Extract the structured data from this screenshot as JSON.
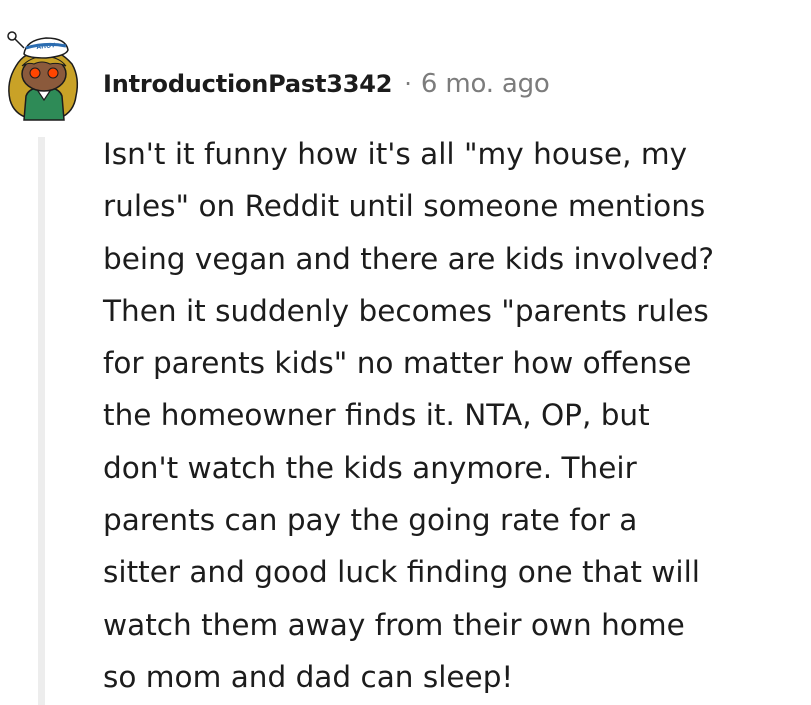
{
  "comment": {
    "author": "IntroductionPast3342",
    "separator": "·",
    "timestamp": "6 mo. ago",
    "avatar_icon": "snoo-sailor-avatar-icon",
    "avatar_hat_text": "AHOY",
    "body_lines": [
      "Isn't it funny how it's all \"my house, my",
      "rules\" on Reddit until someone mentions",
      "being vegan and there are kids involved?",
      "Then it suddenly becomes \"parents rules",
      "for parents kids\" no matter how offense",
      "the homeowner finds it. NTA, OP, but",
      "don't watch the kids anymore. Their",
      "parents can pay the going rate for a",
      "sitter and good luck finding one that will",
      "watch them away from their own home",
      "so mom and dad can sleep!"
    ]
  },
  "colors": {
    "text": "#1c1c1c",
    "meta_text": "#7c7c7c",
    "thread_line": "#ededed",
    "avatar_skin": "#8b5a3c",
    "avatar_hair": "#c9a227",
    "avatar_eyes": "#ff4500",
    "avatar_shirt": "#2e8b57"
  }
}
